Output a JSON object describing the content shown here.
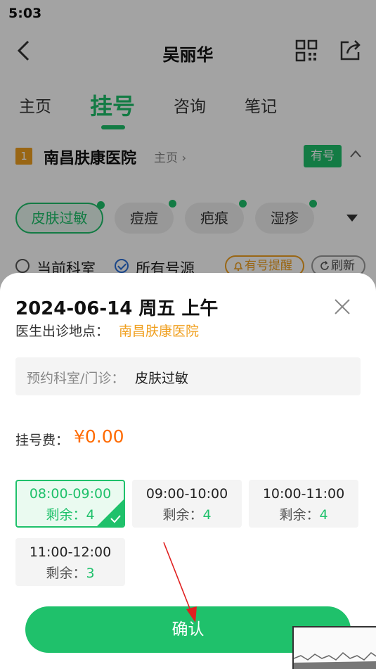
{
  "status_bar": {
    "time": "5:03"
  },
  "nav": {
    "title": "吴丽华",
    "icons": [
      "back-icon",
      "qr-code-icon",
      "share-icon"
    ]
  },
  "tabs": [
    {
      "label": "主页",
      "active": false
    },
    {
      "label": "挂号",
      "active": true
    },
    {
      "label": "咨询",
      "active": false
    },
    {
      "label": "笔记",
      "active": false
    }
  ],
  "hospital": {
    "rank": "1",
    "name": "南昌肤康医院",
    "homepage_link": "主页",
    "availability_badge": "有号"
  },
  "departments": [
    {
      "label": "皮肤过敏",
      "selected": true
    },
    {
      "label": "痘痘",
      "selected": false
    },
    {
      "label": "疤痕",
      "selected": false
    },
    {
      "label": "湿疹",
      "selected": false
    }
  ],
  "filters": {
    "current_dept": "当前科室",
    "all_sources": "所有号源",
    "reminder": "有号提醒",
    "refresh": "刷新"
  },
  "sheet": {
    "title": "2024-06-14 周五 上午",
    "location_label": "医生出诊地点：",
    "location_value": "南昌肤康医院",
    "dept_label": "预约科室/门诊：",
    "dept_value": "皮肤过敏",
    "fee_label": "挂号费：",
    "fee_value": "¥0.00",
    "slots": [
      {
        "time": "08:00-09:00",
        "remaining_label": "剩余：",
        "count": "4",
        "selected": true
      },
      {
        "time": "09:00-10:00",
        "remaining_label": "剩余：",
        "count": "4",
        "selected": false
      },
      {
        "time": "10:00-11:00",
        "remaining_label": "剩余：",
        "count": "4",
        "selected": false
      },
      {
        "time": "11:00-12:00",
        "remaining_label": "剩余：",
        "count": "3",
        "selected": false
      }
    ],
    "confirm_label": "确认"
  },
  "colors": {
    "brand_green": "#1fc16b",
    "accent_orange": "#f0a020",
    "price_orange": "#ff6a00",
    "annotation_red": "#e02020"
  }
}
